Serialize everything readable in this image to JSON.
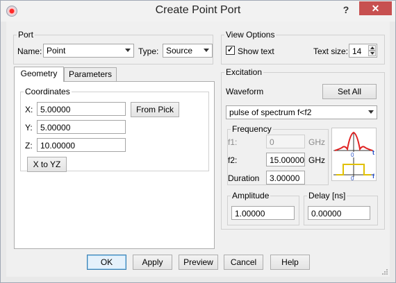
{
  "window": {
    "title": "Create Point Port",
    "help_label": "?",
    "close_label": "✕",
    "app_icon": "app-icon"
  },
  "port": {
    "group_label": "Port",
    "name_label": "Name:",
    "name_value": "Point",
    "type_label": "Type:",
    "type_value": "Source"
  },
  "tabs": [
    {
      "label": "Geometry",
      "active": true
    },
    {
      "label": "Parameters",
      "active": false
    }
  ],
  "coordinates": {
    "group_label": "Coordinates",
    "x_label": "X:",
    "x_value": "5.00000",
    "y_label": "Y:",
    "y_value": "5.00000",
    "z_label": "Z:",
    "z_value": "10.00000",
    "from_pick_label": "From Pick",
    "x_to_yz_label": "X to YZ"
  },
  "view_options": {
    "group_label": "View Options",
    "show_text_label": "Show text",
    "show_text_checked": true,
    "text_size_label": "Text size:",
    "text_size_value": "14"
  },
  "excitation": {
    "group_label": "Excitation",
    "waveform_label": "Waveform",
    "set_all_label": "Set All",
    "waveform_value": "pulse of spectrum f<f2",
    "frequency": {
      "group_label": "Frequency",
      "f1_label": "f1:",
      "f1_value": "0",
      "f1_unit": "GHz",
      "f2_label": "f2:",
      "f2_value": "15.00000",
      "f2_unit": "GHz",
      "duration_label": "Duration",
      "duration_value": "3.00000"
    },
    "amplitude": {
      "group_label": "Amplitude",
      "value": "1.00000"
    },
    "delay": {
      "group_label": "Delay [ns]",
      "value": "0.00000"
    },
    "preview_icons": {
      "time_axis_label": "t",
      "freq_axis_label": "f",
      "origin_label": "0"
    },
    "colors": {
      "time_wave": "#e02020",
      "spectrum": "#e0c000"
    }
  },
  "footer": {
    "ok_label": "OK",
    "apply_label": "Apply",
    "preview_label": "Preview",
    "cancel_label": "Cancel",
    "help_label": "Help"
  }
}
